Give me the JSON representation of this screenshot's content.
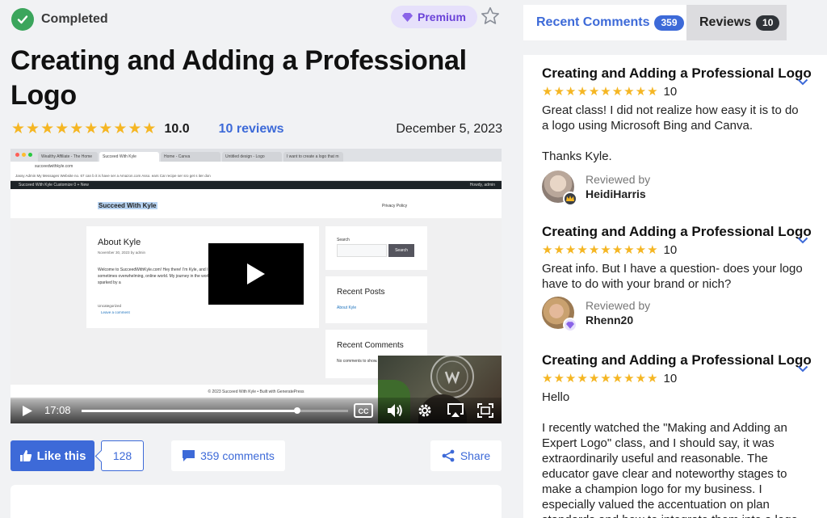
{
  "status": {
    "label": "Completed"
  },
  "badge": {
    "premium": "Premium"
  },
  "title": "Creating and Adding a Professional Logo",
  "rating": {
    "stars": 10,
    "score": "10.0",
    "reviews_link": "10 reviews",
    "date": "December 5, 2023"
  },
  "video": {
    "time": "17:08",
    "progress_fraction": 0.81,
    "browser_tabs": [
      "Wealthy Affiliate - The Home",
      "Succeed With Kyle",
      "Home - Canva",
      "Untitled design - Logo",
      "I want to create a logo that m"
    ],
    "url": "succeedwithkyle.com",
    "bookmarks": "Jassy Admin   My Messages   Website   no.   67   can   b   it is   have   ser a   Amazon.com Asso.   ears   Car   recipe   ser   sro   get   s   iter   don",
    "wp_bar": "Succeed With Kyle   Customize   0   + New",
    "howdy": "Howdy, admin",
    "site_title": "Succeed With Kyle",
    "privacy": "Privacy Policy",
    "post_title": "About Kyle",
    "post_meta": "November 30, 2023 by admin",
    "post_body": "Welcome to SucceedWithKyle.com! Hey there! I'm Kyle, and I created this website to help people succeed in these sometimes overwhelming, online world. My journey in the world of online businesses began over 21 years ago, sparked by a",
    "post_cat": "Uncategorized",
    "post_comment": "Leave a comment",
    "search_label": "Search",
    "search_button": "Search",
    "recent_posts": "Recent Posts",
    "recent_post_link": "About Kyle",
    "recent_comments": "Recent Comments",
    "no_comments": "No comments to show.",
    "footer": "© 2023 Succeed With Kyle • Built with GeneratePress"
  },
  "actions": {
    "like": "Like this",
    "like_count": "128",
    "comments": "359 comments",
    "share": "Share"
  },
  "tabs": {
    "recent_label": "Recent Comments",
    "recent_count": "359",
    "reviews_label": "Reviews",
    "reviews_count": "10"
  },
  "reviews": [
    {
      "title": "Creating and Adding a Professional Logo",
      "score": "10",
      "body": "Great class! I did not realize how easy it is to do a logo using Microsoft Bing and Canva.\n\nThanks Kyle.",
      "reviewed_by": "Reviewed by",
      "name": "HeidiHarris"
    },
    {
      "title": "Creating and Adding a Professional Logo",
      "score": "10",
      "body": "Great info. But I have a question- does your logo have to do with your brand or nich?",
      "reviewed_by": "Reviewed by",
      "name": "Rhenn20"
    },
    {
      "title": "Creating and Adding a Professional Logo",
      "score": "10",
      "body": "Hello\n\nI recently  watched the \"Making and Adding an Expert Logo\" class, and I should say, it was extraordinarily useful and reasonable. The educator gave clear and noteworthy stages to make a champion logo for my business. I especially valued the accentuation on plan standards and how to integrate them into a logo"
    }
  ],
  "colors": {
    "accent": "#3d6ad8",
    "star": "#f5b623",
    "success": "#3ba55c",
    "premium": "#6a42d8"
  }
}
